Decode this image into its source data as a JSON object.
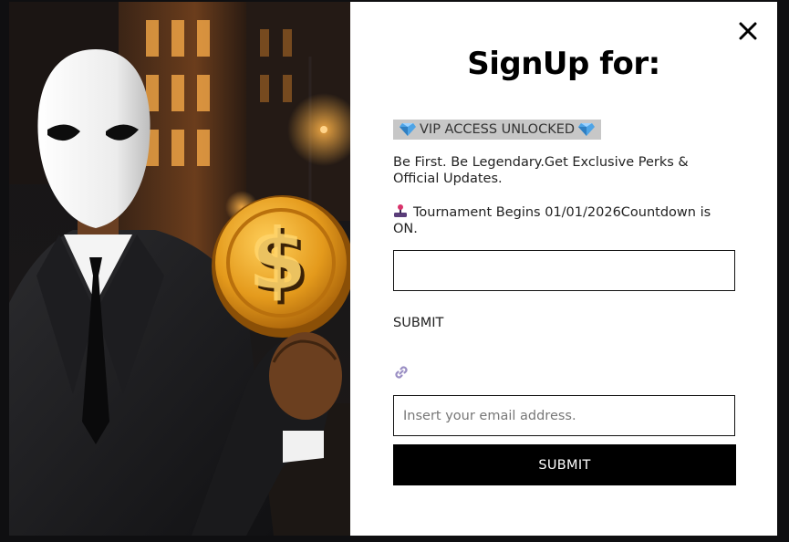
{
  "popup": {
    "title": "SignUp for:",
    "vip_banner": {
      "icon": "gem-icon",
      "text": "VIP ACCESS UNLOCKED"
    },
    "tagline": "Be First. Be Legendary.Get Exclusive Perks & Official Updates.",
    "tournament": {
      "icon": "joystick-icon",
      "text": "Tournament Begins 01/01/2026Countdown is ON."
    },
    "first_field": {
      "value": "",
      "placeholder": ""
    },
    "first_submit_label": "SUBMIT",
    "link_icon": "link-icon",
    "email_field": {
      "value": "",
      "placeholder": "Insert your email address."
    },
    "submit_button_label": "SUBMIT",
    "close_icon": "close-icon"
  },
  "colors": {
    "modal_background": "#ffffff",
    "vip_banner_background": "#c7c7c7",
    "submit_button_background": "#000000",
    "submit_button_text": "#ffffff",
    "page_backdrop": "#0f0f11",
    "coin_gold": "#e49a1c",
    "mask_white": "#f2f2f2"
  }
}
